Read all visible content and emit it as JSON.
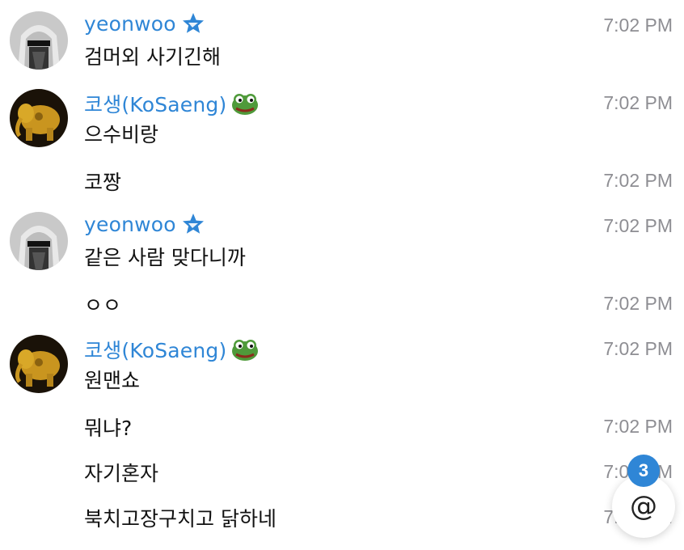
{
  "colors": {
    "accent": "#2f86d6",
    "time_gray": "#8e8e93",
    "text": "#111111"
  },
  "messages": [
    {
      "sender": "yeonwoo",
      "sender_badge": "star-badge-icon",
      "text": "검머외 사기긴해",
      "time": "7:02 PM"
    },
    {
      "sender": "코생(KoSaeng)",
      "sender_badge": "pepe-frog-icon",
      "text": "으수비랑",
      "time": "7:02 PM"
    },
    {
      "text": "코짱",
      "time": "7:02 PM"
    },
    {
      "sender": "yeonwoo",
      "sender_badge": "star-badge-icon",
      "text": "같은 사람 맞다니까",
      "time": "7:02 PM"
    },
    {
      "text": "ㅇㅇ",
      "time": "7:02 PM"
    },
    {
      "sender": "코생(KoSaeng)",
      "sender_badge": "pepe-frog-icon",
      "text": "원맨쇼",
      "time": "7:02 PM"
    },
    {
      "text": "뭐냐?",
      "time": "7:02 PM"
    },
    {
      "text": "자기혼자",
      "time": "7:02 PM"
    },
    {
      "text": "북치고장구치고 닭하네",
      "time": "7:02 PM"
    }
  ],
  "mention_button": {
    "symbol": "@",
    "unread_count": "3"
  }
}
